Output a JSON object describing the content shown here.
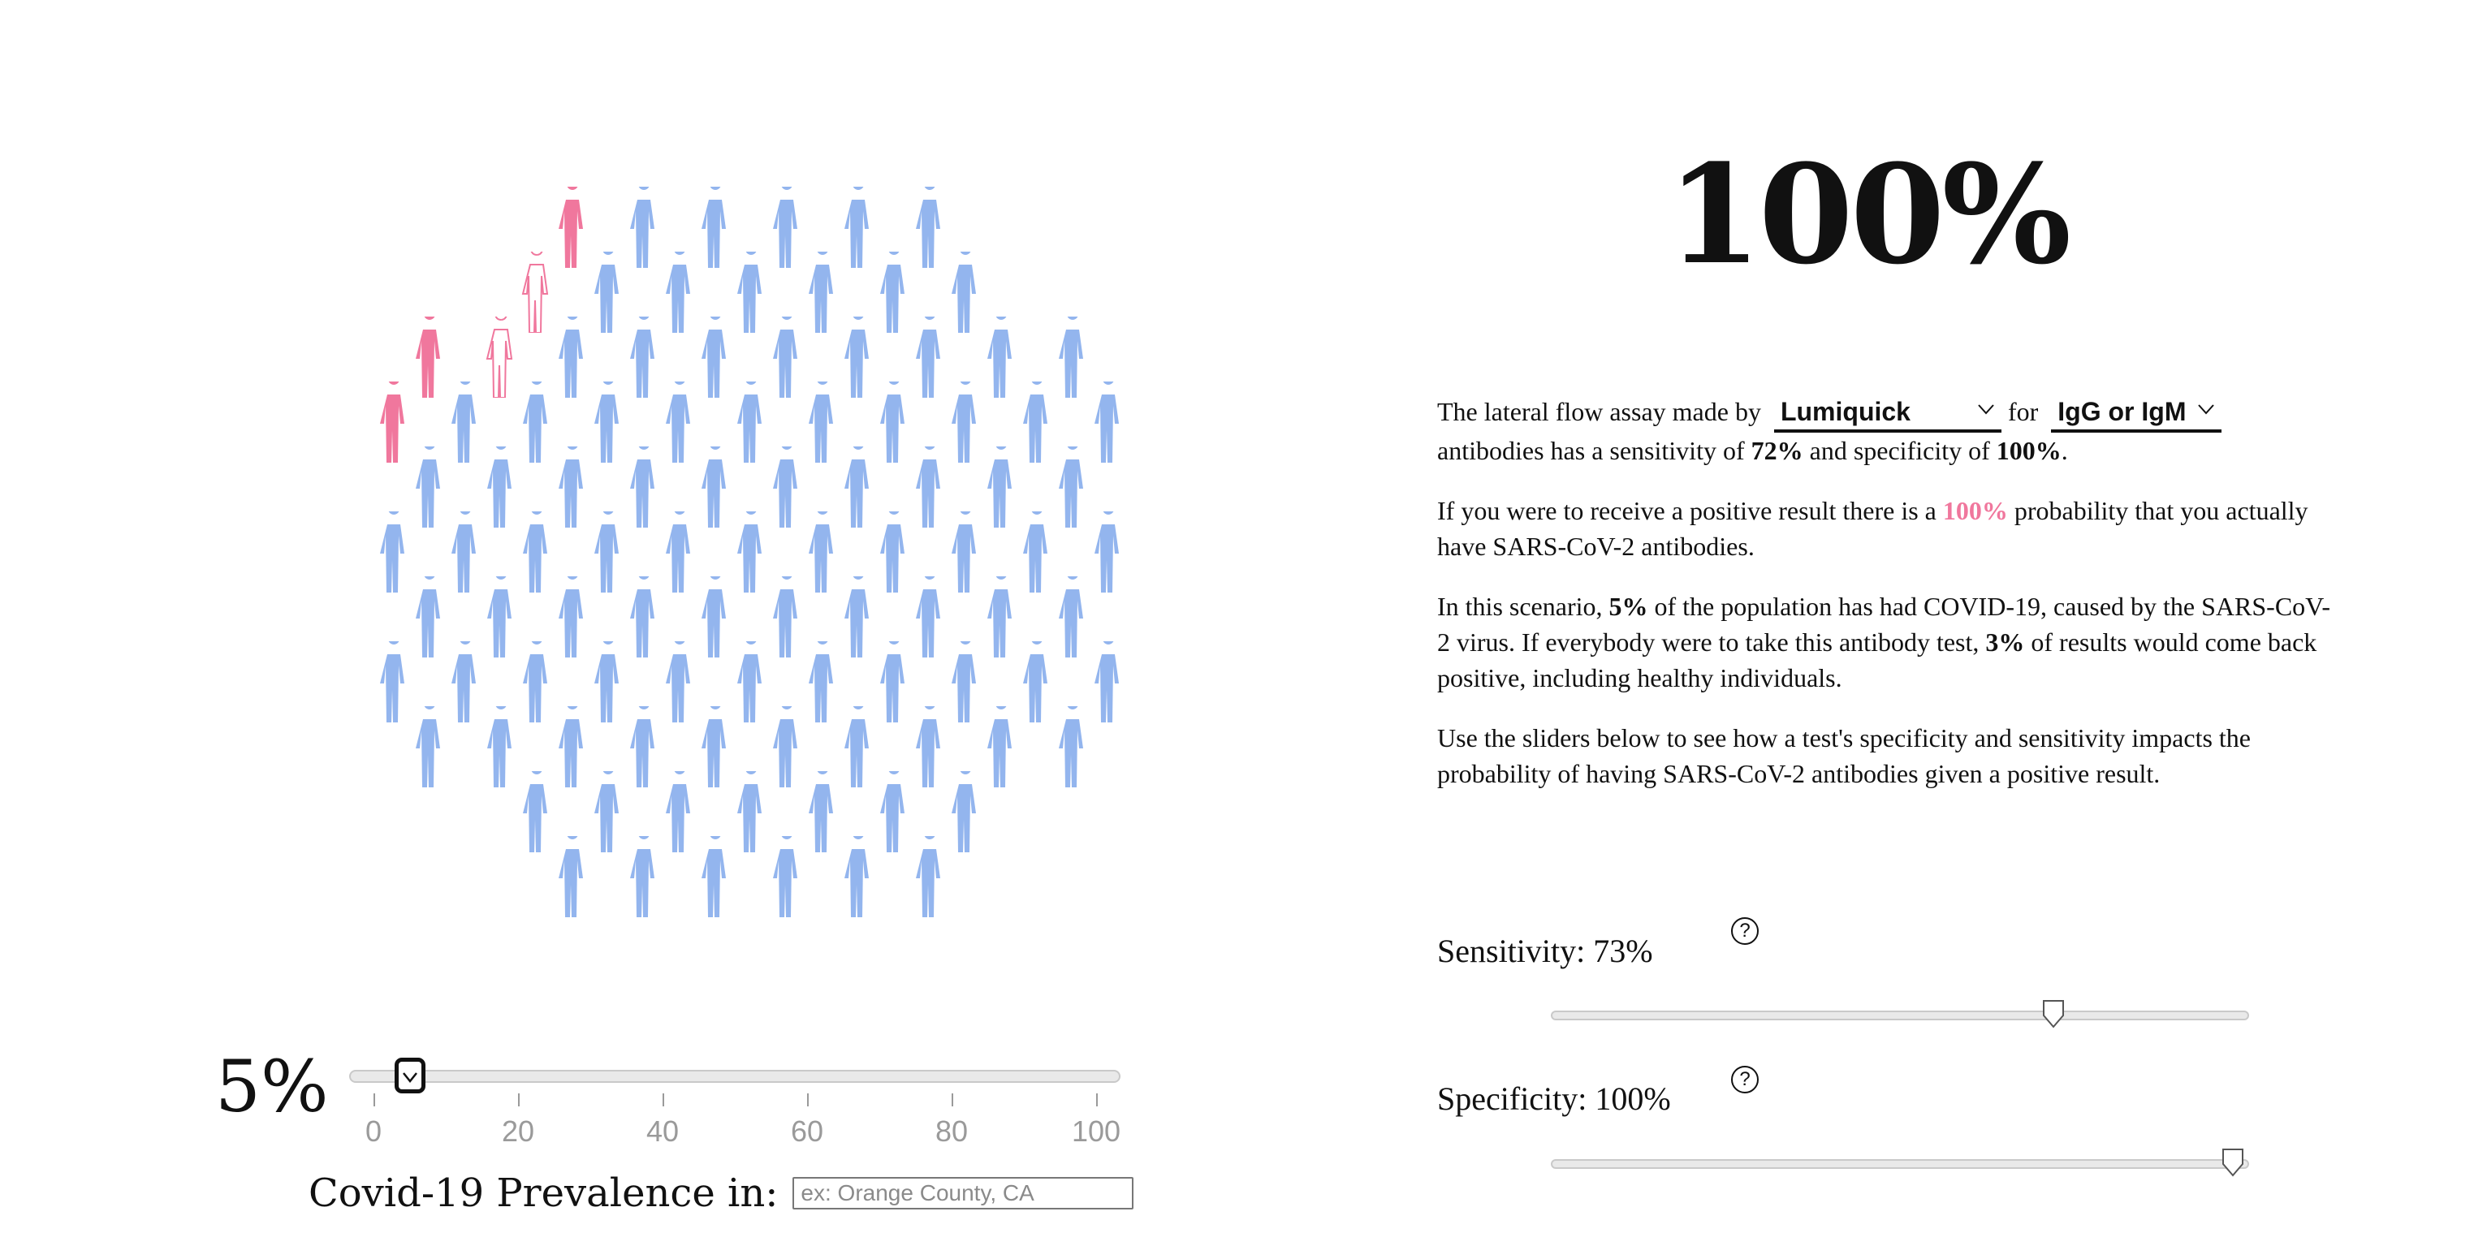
{
  "colors": {
    "healthy": "#93b5ee",
    "infected_positive": "#f0779d",
    "infected_negative_outline": "#f0779d"
  },
  "icons": {
    "person": "person-silhouette-icon",
    "wheelchair": "wheelchair-user-icon",
    "help": "question-mark-circle-icon",
    "chevron": "chevron-down-icon"
  },
  "population": {
    "total": 150,
    "infected_positive": 3,
    "infected_negative": 2
  },
  "prevalence": {
    "value_label": "5%",
    "value": 5,
    "min": 0,
    "max": 100,
    "ticks": [
      "0",
      "20",
      "40",
      "60",
      "80",
      "100"
    ]
  },
  "location": {
    "label": "Covid-19 Prevalence in:",
    "placeholder": "ex: Orange County, CA",
    "value": ""
  },
  "result": {
    "probability": "100%"
  },
  "panel": {
    "p1_pre": "The lateral flow assay made by",
    "manufacturer": "Lumiquick",
    "p1_for": "for",
    "antibody": "IgG or IgM",
    "p1_mid": "antibodies has a sensitivity of",
    "sensitivity_bold": "72%",
    "p1_and": "and specificity of",
    "specificity_bold": "100%",
    "p1_end": ".",
    "p2_pre": "If you were to receive a positive result there is a",
    "p2_prob": "100%",
    "p2_post": "probability that you actually have SARS-CoV-2 antibodies.",
    "p3_pre": "In this scenario,",
    "p3_prev": "5%",
    "p3_mid": "of the population has had COVID-19, caused by the SARS-CoV-2 virus. If everybody were to take this antibody test,",
    "p3_pos": "3%",
    "p3_post": "of results would come back positive, including healthy individuals.",
    "p4": "Use the sliders below to see how a test's specificity and sensitivity impacts the probability of having SARS-CoV-2 antibodies given a positive result."
  },
  "sensitivity": {
    "label": "Sensitivity: 73%",
    "value": 0.73,
    "help": "?"
  },
  "specificity": {
    "label": "Specificity: 100%",
    "value": 1.0,
    "help": "?"
  }
}
